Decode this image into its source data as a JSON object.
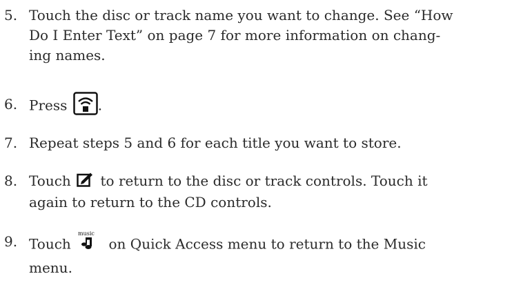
{
  "steps": [
    {
      "number": "5.",
      "lines": [
        "Touch the disc or track name you want to change. See “How",
        "Do I Enter Text” on page 7 for more information on chang-",
        "ing names."
      ]
    },
    {
      "number": "6.",
      "before": "Press",
      "icon": "store-button-icon",
      "after": "."
    },
    {
      "number": "7.",
      "text": "Repeat steps 5 and 6 for each title you want to store."
    },
    {
      "number": "8.",
      "before": "Touch",
      "icon": "edit-icon",
      "after": "to return to the disc or track controls. Touch it",
      "line2": "again to return to the CD controls."
    },
    {
      "number": "9.",
      "before": "Touch",
      "icon": "music-note-icon",
      "icon_label": "music",
      "after": "on Quick Access menu to return to the Music",
      "line2": "menu."
    }
  ]
}
